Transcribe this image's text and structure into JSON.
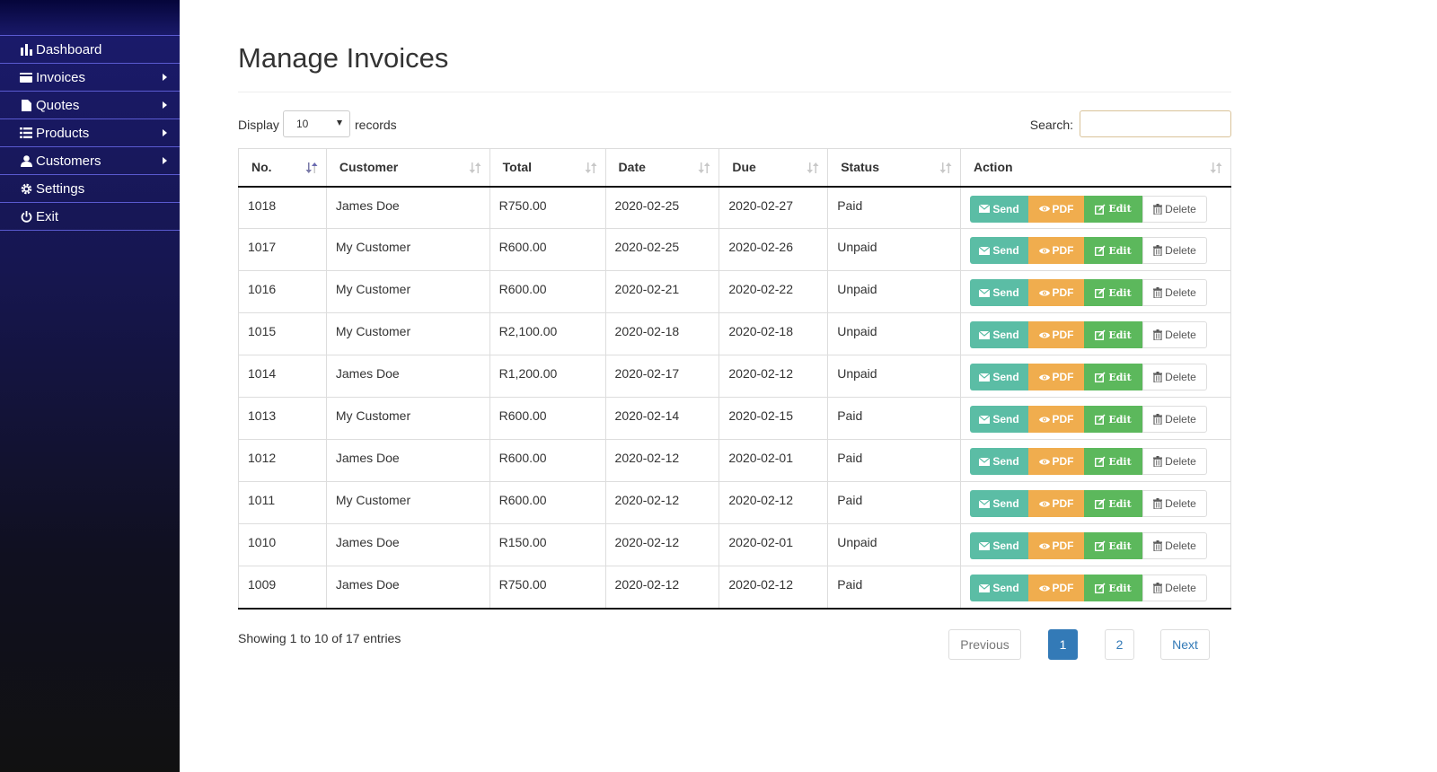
{
  "sidebar": {
    "items": [
      {
        "label": "Dashboard",
        "icon": "bar-chart-icon",
        "submenu": false
      },
      {
        "label": "Invoices",
        "icon": "credit-card-icon",
        "submenu": true
      },
      {
        "label": "Quotes",
        "icon": "file-icon",
        "submenu": true
      },
      {
        "label": "Products",
        "icon": "list-icon",
        "submenu": true
      },
      {
        "label": "Customers",
        "icon": "user-icon",
        "submenu": true
      },
      {
        "label": "Settings",
        "icon": "gear-icon",
        "submenu": false
      },
      {
        "label": "Exit",
        "icon": "power-icon",
        "submenu": false
      }
    ]
  },
  "page": {
    "title": "Manage Invoices"
  },
  "controls": {
    "display_label": "Display",
    "length_value": "10",
    "records_label": "records",
    "search_label": "Search:",
    "search_value": ""
  },
  "table": {
    "columns": [
      "No.",
      "Customer",
      "Total",
      "Date",
      "Due",
      "Status",
      "Action"
    ],
    "rows": [
      {
        "no": "1018",
        "customer": "James Doe",
        "total": "R750.00",
        "date": "2020-02-25",
        "due": "2020-02-27",
        "status": "Paid"
      },
      {
        "no": "1017",
        "customer": "My Customer",
        "total": "R600.00",
        "date": "2020-02-25",
        "due": "2020-02-26",
        "status": "Unpaid"
      },
      {
        "no": "1016",
        "customer": "My Customer",
        "total": "R600.00",
        "date": "2020-02-21",
        "due": "2020-02-22",
        "status": "Unpaid"
      },
      {
        "no": "1015",
        "customer": "My Customer",
        "total": "R2,100.00",
        "date": "2020-02-18",
        "due": "2020-02-18",
        "status": "Unpaid"
      },
      {
        "no": "1014",
        "customer": "James Doe",
        "total": "R1,200.00",
        "date": "2020-02-17",
        "due": "2020-02-12",
        "status": "Unpaid"
      },
      {
        "no": "1013",
        "customer": "My Customer",
        "total": "R600.00",
        "date": "2020-02-14",
        "due": "2020-02-15",
        "status": "Paid"
      },
      {
        "no": "1012",
        "customer": "James Doe",
        "total": "R600.00",
        "date": "2020-02-12",
        "due": "2020-02-01",
        "status": "Paid"
      },
      {
        "no": "1011",
        "customer": "My Customer",
        "total": "R600.00",
        "date": "2020-02-12",
        "due": "2020-02-12",
        "status": "Paid"
      },
      {
        "no": "1010",
        "customer": "James Doe",
        "total": "R150.00",
        "date": "2020-02-12",
        "due": "2020-02-01",
        "status": "Unpaid"
      },
      {
        "no": "1009",
        "customer": "James Doe",
        "total": "R750.00",
        "date": "2020-02-12",
        "due": "2020-02-12",
        "status": "Paid"
      }
    ],
    "actions": {
      "send": "Send",
      "pdf": "PDF",
      "edit": "Edit",
      "delete": "Delete"
    }
  },
  "footer": {
    "info": "Showing 1 to 10 of 17 entries",
    "pagination": {
      "previous": "Previous",
      "pages": [
        "1",
        "2"
      ],
      "current": "1",
      "next": "Next"
    }
  },
  "colors": {
    "send": "#5bbda5",
    "pdf": "#f0ad4e",
    "edit": "#5cb85c",
    "active_page": "#337ab7"
  }
}
